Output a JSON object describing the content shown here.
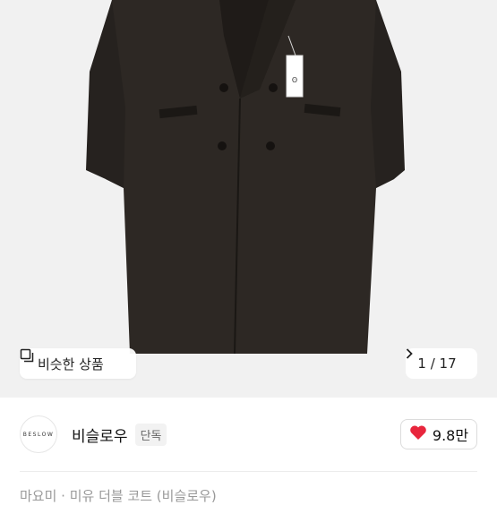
{
  "product_image": {
    "alt": "double-breasted long coat",
    "tag_brand_mark": "ʘ"
  },
  "similar_button": {
    "label": "비슷한 상품",
    "icon": "similar-items-icon"
  },
  "image_counter": {
    "current": "1",
    "separator": "/",
    "total": "17",
    "icon": "chevron-right-icon"
  },
  "seller": {
    "avatar_text": "BESLOW",
    "name": "비슬로우",
    "badge": "단독"
  },
  "like": {
    "icon": "heart-icon",
    "count": "9.8만",
    "color": "#e8263d"
  },
  "product_title": "마요미 · 미유 더블 코트 (비슬로우)"
}
